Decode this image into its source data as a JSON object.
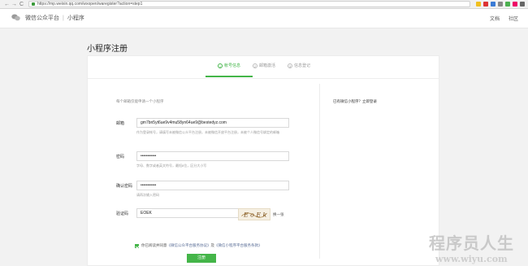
{
  "browser": {
    "url": "https://mp.weixin.qq.com/wxopen/waregister?action=step1",
    "back": "←",
    "forward": "→",
    "reload": "C"
  },
  "topnav": {
    "brand": "微信公众平台",
    "product": "小程序",
    "links": [
      "文档",
      "社区"
    ]
  },
  "page": {
    "title": "小程序注册"
  },
  "steps": [
    {
      "num": "1",
      "label": "帐号信息"
    },
    {
      "num": "2",
      "label": "邮箱激活"
    },
    {
      "num": "3",
      "label": "信息登记"
    }
  ],
  "form": {
    "intro": "每个邮箱仅能申请一个小程序",
    "email": {
      "label": "邮箱",
      "value": "gm7bn5yt6ue9v4mu58yn64ue9@bestedyz.com",
      "hint": "作为登录帐号，请填写未被微信公众平台注册，未被微信开放平台注册，未被个人微信号绑定的邮箱"
    },
    "password": {
      "label": "密码",
      "value": "•••••••••••",
      "hint": "字母、数字或者英文符号，最短8位，区分大小写"
    },
    "confirm": {
      "label": "确认密码",
      "value": "•••••••••••",
      "hint": "请再次输入密码"
    },
    "captcha": {
      "label": "验证码",
      "value": "EOEK",
      "image_text": "E o E k",
      "refresh": "换一张"
    },
    "agree": {
      "prefix": "你已阅读并同意",
      "link1": "《微信公众平台服务协议》",
      "mid": "及",
      "link2": "《微信小程序平台服务条款》"
    },
    "submit": "注册"
  },
  "side": {
    "text": "已有微信小程序？立即登录"
  },
  "watermark": {
    "title": "程序员人生",
    "url": "www.wiyu.com"
  },
  "colors": {
    "accent": "#44b549",
    "link": "#576b95"
  }
}
